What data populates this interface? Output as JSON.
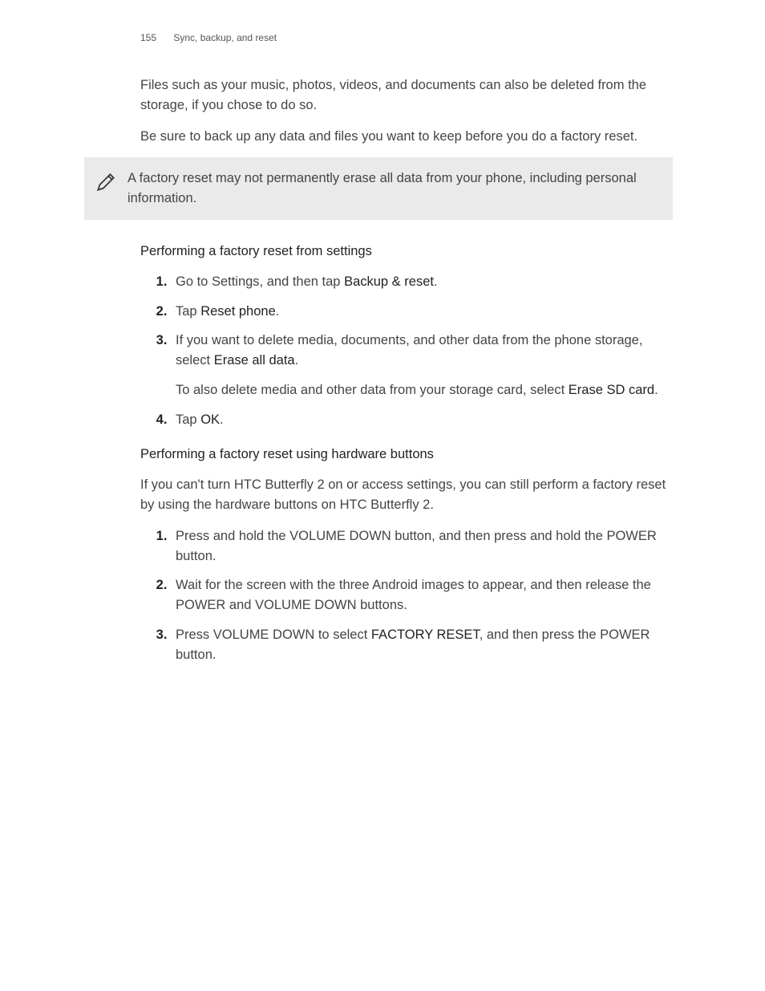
{
  "header": {
    "page_number": "155",
    "section": "Sync, backup, and reset"
  },
  "intro": {
    "p1": "Files such as your music, photos, videos, and documents can also be deleted from the storage, if you chose to do so.",
    "p2": "Be sure to back up any data and files you want to keep before you do a factory reset."
  },
  "note": {
    "text": "A factory reset may not permanently erase all data from your phone, including personal information."
  },
  "section1": {
    "heading": "Performing a factory reset from settings",
    "step1_a": "Go to Settings, and then tap ",
    "step1_b": "Backup & reset",
    "step1_c": ".",
    "step2_a": "Tap ",
    "step2_b": "Reset phone",
    "step2_c": ".",
    "step3_a": "If you want to delete media, documents, and other data from the phone storage, select ",
    "step3_b": "Erase all data",
    "step3_c": ".",
    "step3_extra_a": "To also delete media and other data from your storage card, select ",
    "step3_extra_b": "Erase SD card",
    "step3_extra_c": ".",
    "step4_a": "Tap ",
    "step4_b": "OK",
    "step4_c": "."
  },
  "section2": {
    "heading": "Performing a factory reset using hardware buttons",
    "intro": "If you can't turn HTC Butterfly 2 on or access settings, you can still perform a factory reset by using the hardware buttons on HTC Butterfly 2.",
    "step1": "Press and hold the VOLUME DOWN button, and then press and hold the POWER button.",
    "step2": "Wait for the screen with the three Android images to appear, and then release the POWER and VOLUME DOWN buttons.",
    "step3_a": "Press VOLUME DOWN to select ",
    "step3_b": "FACTORY RESET",
    "step3_c": ", and then press the POWER button."
  }
}
